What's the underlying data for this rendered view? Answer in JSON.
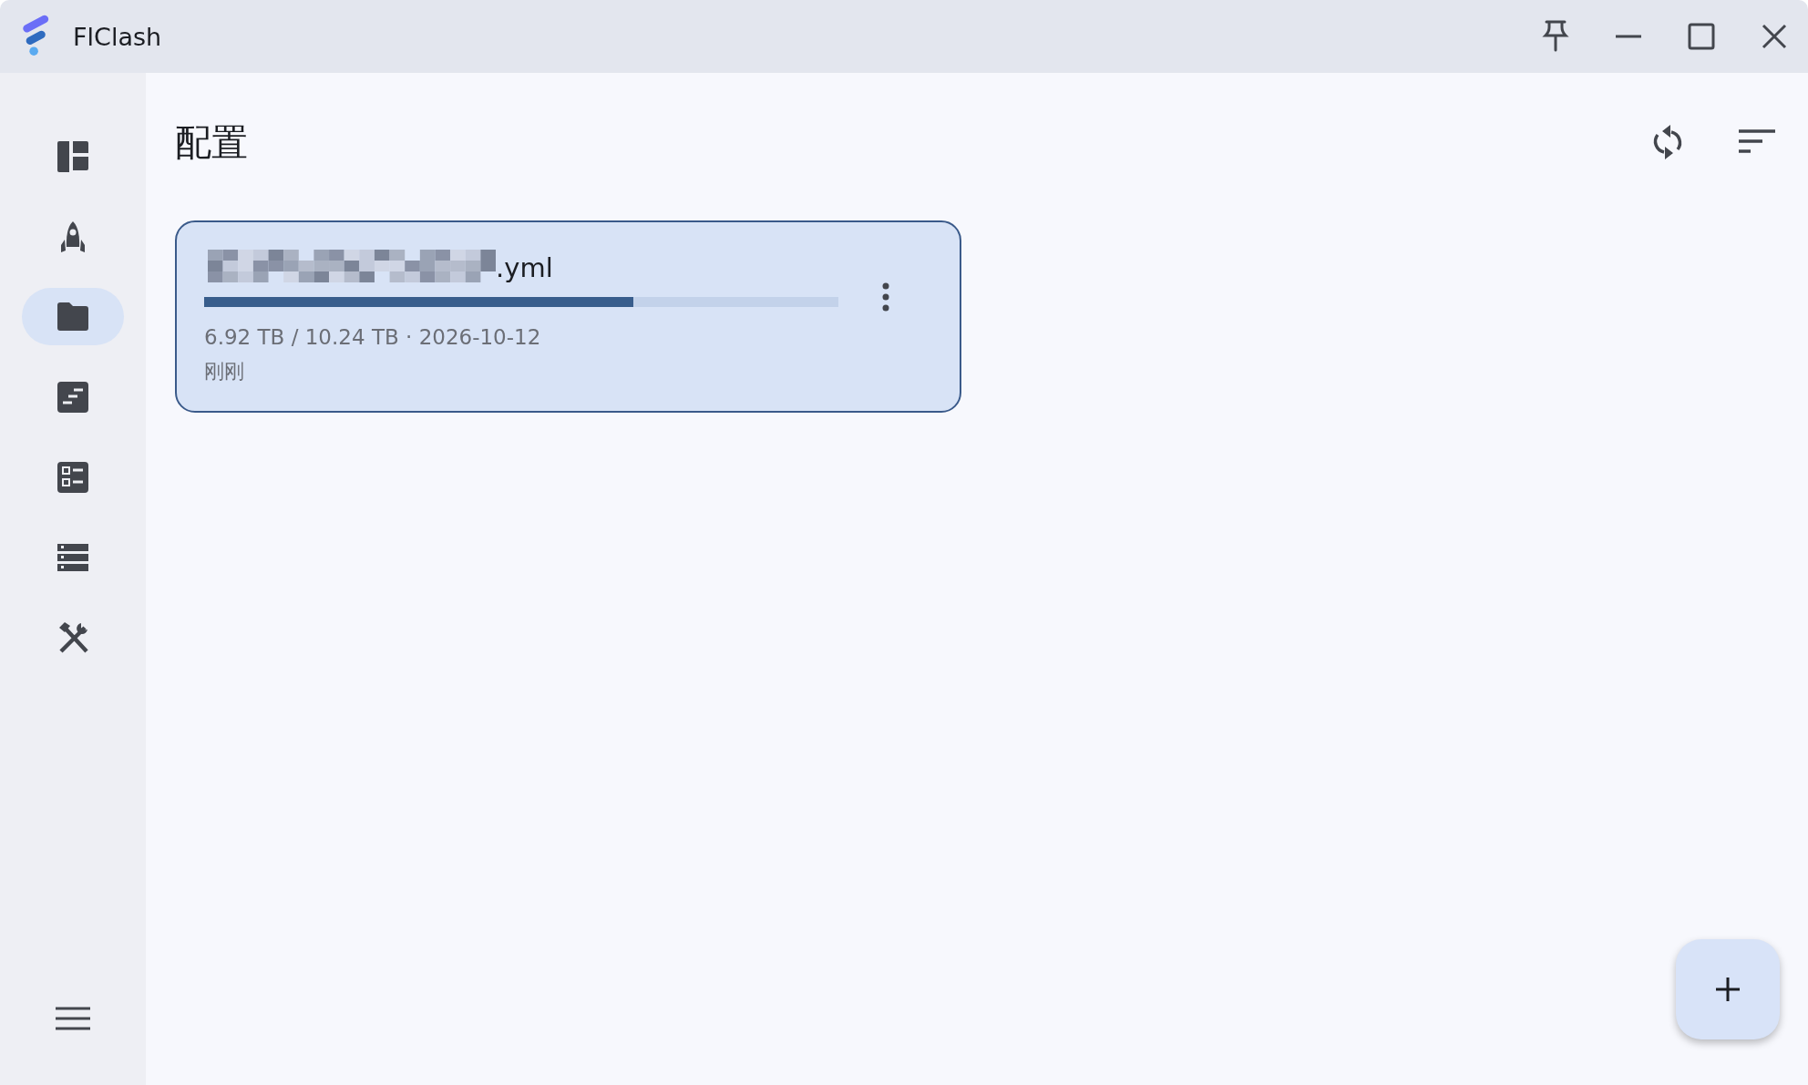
{
  "window": {
    "title": "FlClash"
  },
  "sidebar": {
    "items": [
      {
        "kind": "dashboard",
        "selected": false
      },
      {
        "kind": "proxies",
        "selected": false
      },
      {
        "kind": "profiles",
        "selected": true
      },
      {
        "kind": "requests",
        "selected": false
      },
      {
        "kind": "connections",
        "selected": false
      },
      {
        "kind": "resources",
        "selected": false
      },
      {
        "kind": "tools",
        "selected": false
      }
    ]
  },
  "page": {
    "title": "配置"
  },
  "profiles": [
    {
      "name": ".yml",
      "selected": true,
      "level": 0.677,
      "usage": "6.92 TB / 10.24 TB · 2026-10-12",
      "updated": "刚刚"
    }
  ]
}
